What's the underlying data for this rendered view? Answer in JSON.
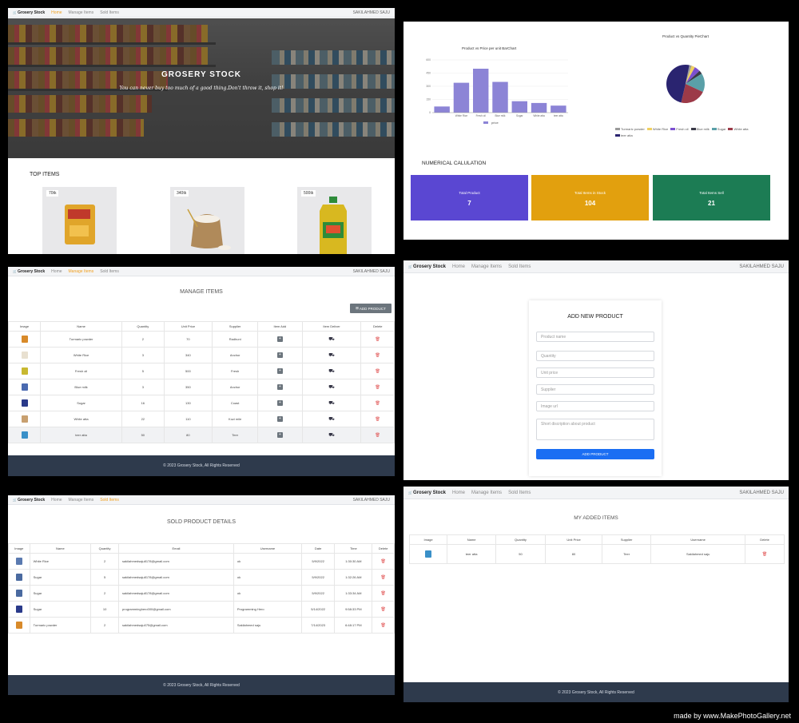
{
  "brand": "Grosery Stock",
  "nav": {
    "home": "Home",
    "manage": "Manage Items",
    "sold": "Sold Items",
    "user": "SAKILAHMED SAJU"
  },
  "footer": "© 2023 Grosery Stock, All Rights Reserved",
  "home": {
    "hero_title": "GROSERY STOCK",
    "hero_subtitle": "You can never buy too much of a good thing.Don't throw it, shop it!",
    "top_items_heading": "TOP ITEMS",
    "cards": [
      {
        "price": "70tk",
        "product": "turmeric-powder-packet"
      },
      {
        "price": "340tk",
        "product": "rice-sack"
      },
      {
        "price": "500tk",
        "product": "oil-bottle"
      }
    ]
  },
  "dashboard": {
    "bar_title": "Product vs Price per unit BarChart",
    "pie_title": "Product vs Quantity PieChart",
    "numerical_heading": "NUMERICAL CALULATION",
    "stats": [
      {
        "label": "Total Product",
        "value": "7",
        "color": "#5a47d2"
      },
      {
        "label": "Total Items in Stock",
        "value": "104",
        "color": "#e2a00e"
      },
      {
        "label": "Total Items Sell",
        "value": "21",
        "color": "#1c7c54"
      }
    ]
  },
  "chart_data": [
    {
      "type": "bar",
      "title": "Product vs Price per unit BarChart",
      "categories": [
        "Turmaric powder",
        "White Rice",
        "Fresh oil",
        "Blue milk",
        "Sugar",
        "White atta",
        "teer atta"
      ],
      "tick_labels": [
        "",
        "White Rice",
        "Fresh oil",
        "Blue milk",
        "Sugar",
        "White atta",
        "teer atta"
      ],
      "series": [
        {
          "name": "price",
          "values": [
            70,
            340,
            500,
            350,
            130,
            110,
            80
          ]
        }
      ],
      "ylim": [
        0,
        600
      ],
      "yticks": [
        "0",
        "150",
        "300",
        "450",
        "600"
      ],
      "color": "#8c84d6"
    },
    {
      "type": "pie",
      "title": "Product vs Quantity PieChart",
      "labels": [
        "Turmaric powder",
        "White Rice",
        "Fresh oil",
        "Blue milk",
        "Sugar",
        "White atta",
        "teer atta"
      ],
      "values": [
        2,
        3,
        5,
        3,
        16,
        22,
        50
      ],
      "colors": [
        "#9a9a9a",
        "#f0d060",
        "#7b4fd0",
        "#3a3a48",
        "#5aa0a8",
        "#9c3a48",
        "#2a2470"
      ]
    }
  ],
  "manage": {
    "title": "MANAGE ITEMS",
    "add_button": "ADD PRODUCT",
    "headers": [
      "Image",
      "Name",
      "Quantity",
      "Unit Price",
      "Supplier",
      "Item Add",
      "Item Deliver",
      "Delete"
    ],
    "rows": [
      {
        "name": "Turmaric powder",
        "qty": "2",
        "price": "70",
        "supplier": "Radhuni",
        "thumb": "#d88a2a"
      },
      {
        "name": "White Rice",
        "qty": "3",
        "price": "340",
        "supplier": "Anchor",
        "thumb": "#e8e0d0"
      },
      {
        "name": "Fresh oil",
        "qty": "5",
        "price": "500",
        "supplier": "Fresh",
        "thumb": "#c8b830"
      },
      {
        "name": "Blue milk",
        "qty": "3",
        "price": "350",
        "supplier": "Anchor",
        "thumb": "#4a6ab0"
      },
      {
        "name": "Sugar",
        "qty": "16",
        "price": "130",
        "supplier": "Coast",
        "thumb": "#2a3a8a"
      },
      {
        "name": "White atta",
        "qty": "22",
        "price": "110",
        "supplier": "Kozi mile",
        "thumb": "#c8a070"
      },
      {
        "name": "teer atta",
        "qty": "50",
        "price": "80",
        "supplier": "Teer",
        "thumb": "#3a90c8"
      }
    ]
  },
  "add_product": {
    "title": "ADD NEW PRODUCT",
    "fields": [
      "Product name",
      "Quantity",
      "Unit price",
      "Supplier",
      "Image url",
      "Short discription about product"
    ],
    "button": "ADD PRODUCT"
  },
  "sold": {
    "title": "SOLD PRODUCT DETAILS",
    "headers": [
      "Image",
      "Name",
      "Quantity",
      "Email",
      "Username",
      "Date",
      "Time",
      "Delete"
    ],
    "rows": [
      {
        "name": "White Rice",
        "qty": "2",
        "email": "sakilahmedsaju8178@gmail.com",
        "username": "ok",
        "date": "5/9/2022",
        "time": "1:30:30 AM",
        "thumb": "#5a7ab0"
      },
      {
        "name": "Sugar",
        "qty": "5",
        "email": "sakilahmedsaju8178@gmail.com",
        "username": "ok",
        "date": "5/9/2022",
        "time": "1:32:26 AM",
        "thumb": "#4a6aa0"
      },
      {
        "name": "Sugar",
        "qty": "2",
        "email": "sakilahmedsaju8178@gmail.com",
        "username": "ok",
        "date": "5/9/2022",
        "time": "1:33:34 AM",
        "thumb": "#4a6aa0"
      },
      {
        "name": "Sugar",
        "qty": "10",
        "email": "programminghero000@gmail.com",
        "username": "Programming Hero",
        "date": "5/14/2022",
        "time": "9:58:33 PM",
        "thumb": "#2a3a8a"
      },
      {
        "name": "Turmaric powder",
        "qty": "2",
        "email": "sakilahmedsaju075@gmail.com",
        "username": "Sakilahmed saju",
        "date": "7/14/2023",
        "time": "6:48:17 PM",
        "thumb": "#d88a2a"
      }
    ]
  },
  "my_items": {
    "title": "MY ADDED ITEMS",
    "headers": [
      "Image",
      "Name",
      "Quantity",
      "Unit Price",
      "Supplier",
      "Username",
      "Delete"
    ],
    "rows": [
      {
        "name": "teer atta",
        "qty": "50",
        "price": "80",
        "supplier": "Teer",
        "username": "Sakilahmed saju",
        "thumb": "#3a90c8"
      }
    ]
  },
  "credit": "made by www.MakePhotoGallery.net"
}
